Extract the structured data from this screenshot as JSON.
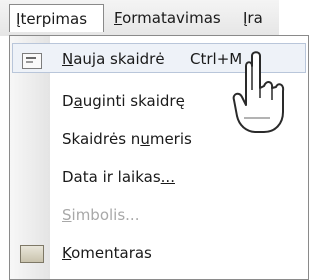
{
  "menubar": {
    "items": [
      {
        "label": "Įterpimas",
        "accel": "Į",
        "rest": "terpimas"
      },
      {
        "label": "Formatavimas",
        "accel": "F",
        "rest": "ormatavimas"
      },
      {
        "label": "Įra"
      }
    ]
  },
  "menu": {
    "new_slide": {
      "accel": "N",
      "rest": "auja skaidrė",
      "shortcut": "Ctrl+M"
    },
    "duplicate_slide": {
      "pre": "D",
      "accel": "a",
      "rest": "uginti skaidrę"
    },
    "slide_number": {
      "pre": "Skaidrės n",
      "accel": "u",
      "rest": "meris"
    },
    "date_time": {
      "pre": "Data ir laikas",
      "accel": "...",
      "rest": ""
    },
    "symbol": {
      "accel": "S",
      "rest": "imbolis..."
    },
    "comment": {
      "accel": "K",
      "rest": "omentaras"
    }
  },
  "icons": {
    "new_slide": "new-slide-icon",
    "comment": "comment-icon",
    "cursor": "hand-pointer-icon"
  },
  "colors": {
    "highlight_bg": "#eef2f8",
    "highlight_border": "#b9c6da",
    "disabled_text": "#a8a8a8"
  }
}
